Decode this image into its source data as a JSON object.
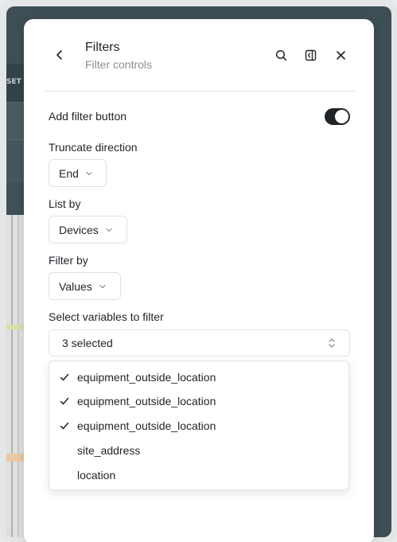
{
  "background": {
    "strip_label": "SET"
  },
  "panel": {
    "title": "Filters",
    "subtitle": "Filter controls",
    "header_icons": [
      "back-chevron-icon",
      "search-icon",
      "sidebar-collapse-icon",
      "close-icon"
    ]
  },
  "add_filter": {
    "label": "Add filter button",
    "enabled": true
  },
  "truncate": {
    "label": "Truncate direction",
    "value": "End"
  },
  "list_by": {
    "label": "List by",
    "value": "Devices"
  },
  "filter_by": {
    "label": "Filter by",
    "value": "Values"
  },
  "variables": {
    "label": "Select variables to filter",
    "summary": "3 selected",
    "options": [
      {
        "label": "equipment_outside_location",
        "checked": true
      },
      {
        "label": "equipment_outside_location",
        "checked": true
      },
      {
        "label": "equipment_outside_location",
        "checked": true
      },
      {
        "label": "site_address",
        "checked": false
      },
      {
        "label": "location",
        "checked": false
      }
    ]
  },
  "colors": {
    "toggle_on": "#1f2328",
    "panel_bg": "#ffffff",
    "backdrop": "#3e4e55",
    "muted_text": "#8a8f95"
  }
}
